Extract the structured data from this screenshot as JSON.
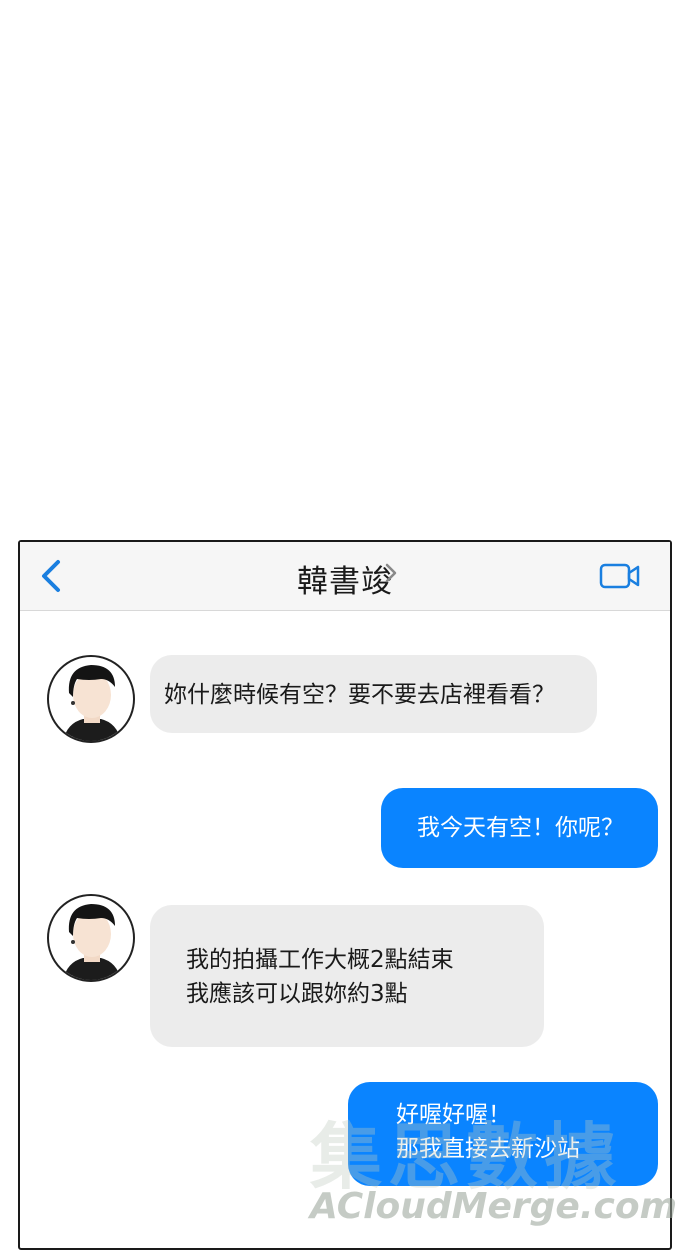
{
  "header": {
    "contact_name": "韓書竣",
    "back_icon": "chevron-left-icon",
    "detail_icon": "chevron-right-icon",
    "video_icon": "video-camera-icon"
  },
  "messages": [
    {
      "sender": "contact",
      "lines": [
        "妳什麼時候有空？要不要去店裡看看？"
      ]
    },
    {
      "sender": "me",
      "lines": [
        "我今天有空！你呢？"
      ]
    },
    {
      "sender": "contact",
      "lines": [
        "我的拍攝工作大概2點結束",
        "我應該可以跟妳約3點"
      ]
    },
    {
      "sender": "me",
      "lines": [
        "好喔好喔！",
        "那我直接去新沙站"
      ]
    }
  ],
  "watermark": {
    "text": "ACloudMerge.com",
    "text_cn": "集思數據"
  },
  "colors": {
    "outgoing_bubble": "#0a84ff",
    "incoming_bubble": "#ececec",
    "accent": "#1a7fe0"
  }
}
